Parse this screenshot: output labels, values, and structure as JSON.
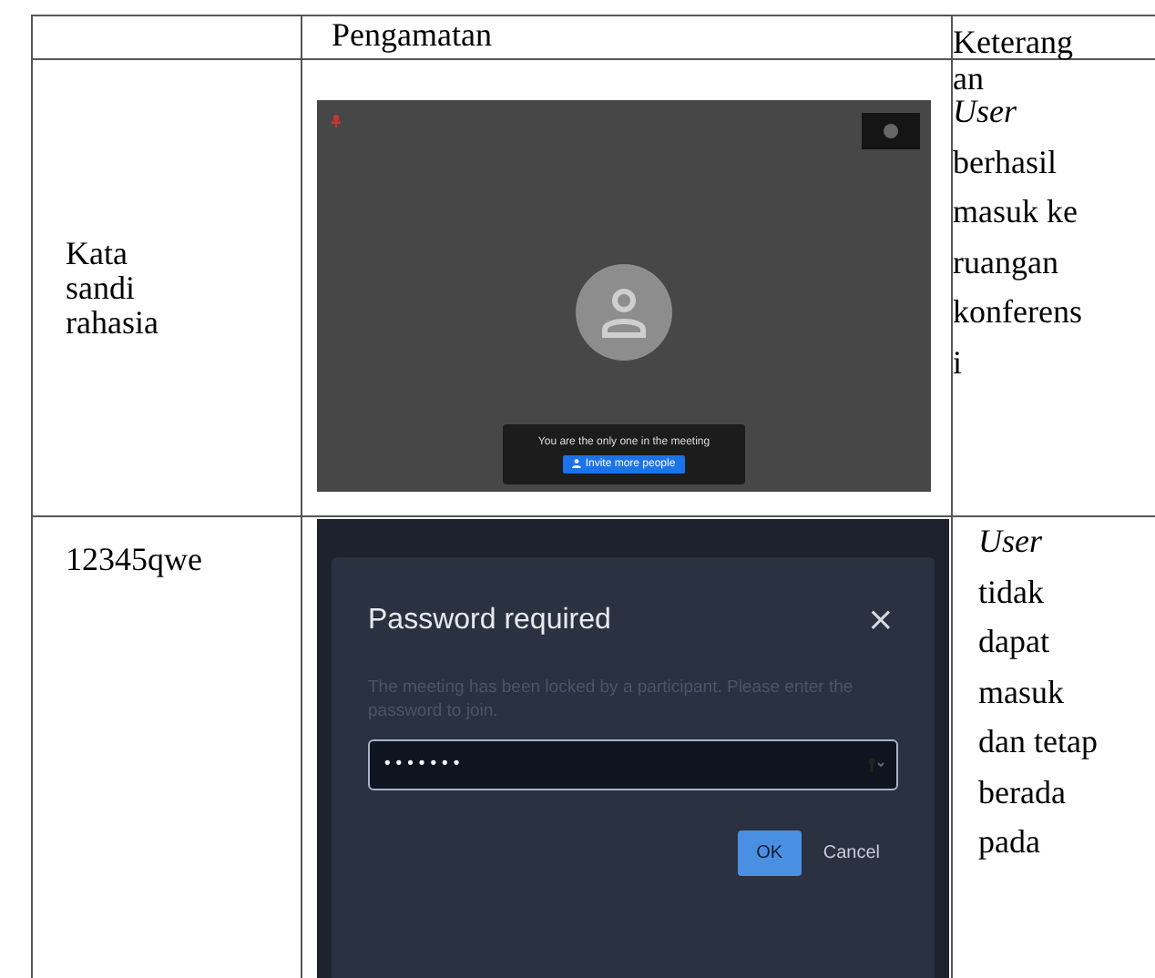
{
  "table": {
    "header": {
      "column_2": "Pengamatan",
      "column_3": "Keterangan"
    },
    "rows": [
      {
        "kind": "meeting",
        "input": "Kata sandi rahasia",
        "screen": {
          "message": "You are the only one in the meeting",
          "invite_button": "Invite more people"
        },
        "note": "*User* berhasil masuk ke ruangan konferensi"
      },
      {
        "kind": "password_dialog",
        "input": "12345qwe",
        "screen": {
          "title": "Password required",
          "close": "×",
          "message": "The meeting has been locked by a participant. Please enter the password to join.",
          "password": "•••••••",
          "ok_button": "OK",
          "cancel_button": "Cancel"
        },
        "note": "*User* tidak dapat masuk dan tetap berada pada"
      }
    ]
  }
}
